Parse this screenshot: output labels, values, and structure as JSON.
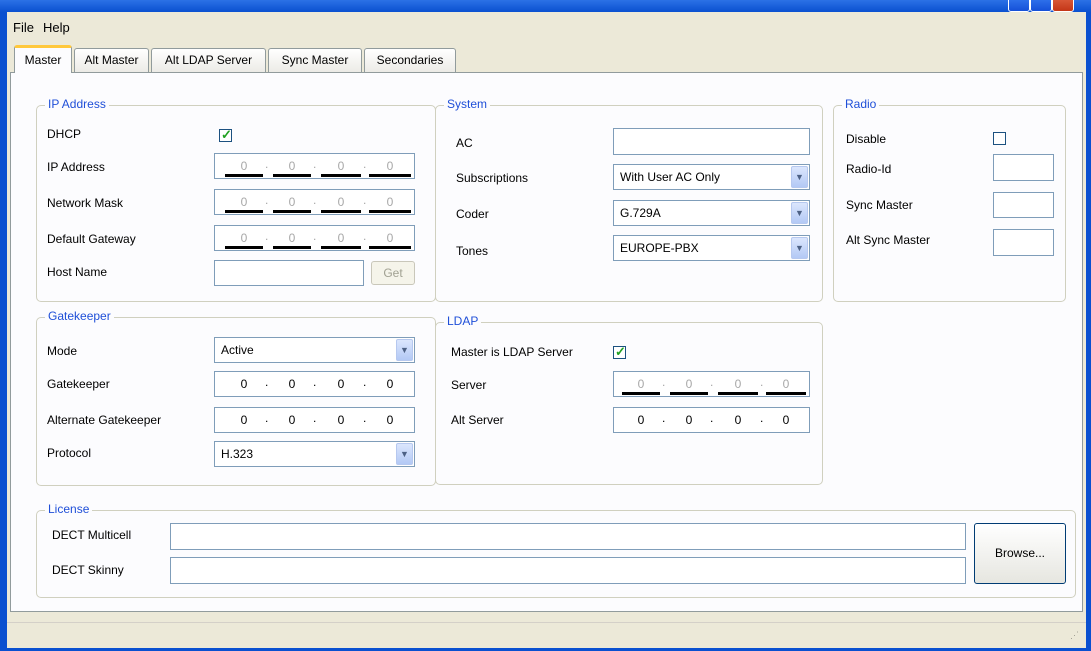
{
  "menu": {
    "file": "File",
    "help": "Help"
  },
  "tabs": [
    "Master",
    "Alt Master",
    "Alt LDAP Server",
    "Sync Master",
    "Secondaries"
  ],
  "ip_address": {
    "title": "IP Address",
    "dhcp_label": "DHCP",
    "dhcp_checked": true,
    "ip_label": "IP Address",
    "ip_value": [
      "0",
      "0",
      "0",
      "0"
    ],
    "mask_label": "Network Mask",
    "mask_value": [
      "0",
      "0",
      "0",
      "0"
    ],
    "gateway_label": "Default Gateway",
    "gateway_value": [
      "0",
      "0",
      "0",
      "0"
    ],
    "host_label": "Host Name",
    "host_value": "",
    "get_label": "Get"
  },
  "system": {
    "title": "System",
    "ac_label": "AC",
    "ac_value": "",
    "subscriptions_label": "Subscriptions",
    "subscriptions_value": "With User AC Only",
    "coder_label": "Coder",
    "coder_value": "G.729A",
    "tones_label": "Tones",
    "tones_value": "EUROPE-PBX"
  },
  "radio": {
    "title": "Radio",
    "disable_label": "Disable",
    "disable_checked": false,
    "radio_id_label": "Radio-Id",
    "radio_id_value": "",
    "sync_master_label": "Sync Master",
    "sync_master_value": "",
    "alt_sync_master_label": "Alt Sync Master",
    "alt_sync_master_value": ""
  },
  "gatekeeper": {
    "title": "Gatekeeper",
    "mode_label": "Mode",
    "mode_value": "Active",
    "gatekeeper_label": "Gatekeeper",
    "gatekeeper_value": [
      "0",
      "0",
      "0",
      "0"
    ],
    "alt_gatekeeper_label": "Alternate Gatekeeper",
    "alt_gatekeeper_value": [
      "0",
      "0",
      "0",
      "0"
    ],
    "protocol_label": "Protocol",
    "protocol_value": "H.323"
  },
  "ldap": {
    "title": "LDAP",
    "master_is_server_label": "Master is LDAP Server",
    "master_is_server_checked": true,
    "server_label": "Server",
    "server_value": [
      "0",
      "0",
      "0",
      "0"
    ],
    "alt_server_label": "Alt Server",
    "alt_server_value": [
      "0",
      "0",
      "0",
      "0"
    ]
  },
  "license": {
    "title": "License",
    "multicell_label": "DECT Multicell",
    "multicell_value": "",
    "skinny_label": "DECT Skinny",
    "skinny_value": "",
    "browse_label": "Browse..."
  },
  "icons": {
    "dropdown": "chevron-down-icon",
    "check": "checkmark-icon"
  },
  "colors": {
    "group_title": "#1f4fd8",
    "titlebar": "#0a50d0",
    "tab_highlight": "#ffc83c"
  }
}
